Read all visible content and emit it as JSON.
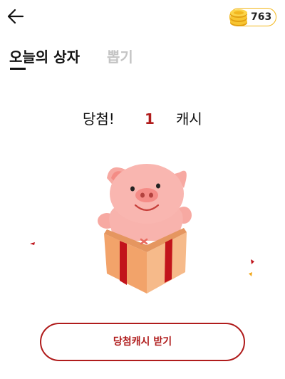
{
  "header": {
    "back_icon": "arrow-left-icon",
    "coin_icon": "gold-coin-stack-icon",
    "coin_count": "763"
  },
  "tabs": [
    {
      "label": "오늘의 상자",
      "active": true
    },
    {
      "label": "뽑기",
      "active": false
    }
  ],
  "result": {
    "prefix": "당첨!",
    "amount": "1",
    "suffix": "캐시"
  },
  "illustration": {
    "icon": "pig-in-gift-box-icon"
  },
  "claim_button": {
    "label": "당첨캐시 받기"
  },
  "colors": {
    "accent": "#b01c1c",
    "coin_border": "#f3b71b",
    "tab_inactive": "#c4c4c4"
  }
}
